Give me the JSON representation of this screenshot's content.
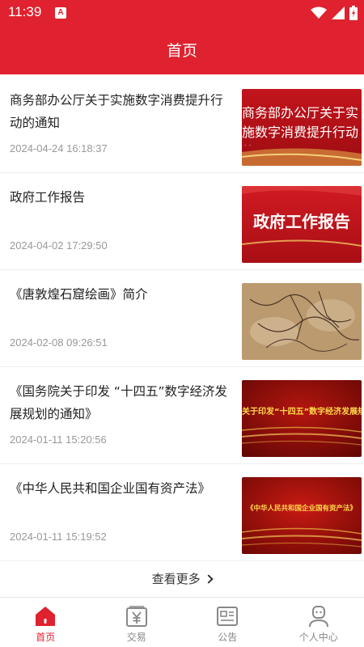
{
  "status_bar": {
    "time": "11:39",
    "notif_letter": "A"
  },
  "header": {
    "title": "首页"
  },
  "articles": [
    {
      "title": "商务部办公厅关于实施数字消费提升行动的通知",
      "time": "2024-04-24 16:18:37",
      "thumb_text": "商务部办公厅关于实施数字消费提升行动的通"
    },
    {
      "title": "政府工作报告",
      "time": "2024-04-02 17:29:50",
      "thumb_text": "政府工作报告"
    },
    {
      "title": "《唐敦煌石窟绘画》简介",
      "time": "2024-02-08 09:26:51",
      "thumb_text": ""
    },
    {
      "title": "《国务院关于印发 “十四五”数字经济发展规划的通知》",
      "time": "2024-01-11 15:20:56",
      "thumb_text": "关于印发“十四五”数字经济发展规划"
    },
    {
      "title": "《中华人民共和国企业国有资产法》",
      "time": "2024-01-11 15:19:52",
      "thumb_text": "《中华人民共和国企业国有资产法》"
    }
  ],
  "more_label": "查看更多",
  "tabs": [
    {
      "label": "首页",
      "icon": "home-icon",
      "active": true
    },
    {
      "label": "交易",
      "icon": "yuan-icon",
      "active": false
    },
    {
      "label": "公告",
      "icon": "notice-icon",
      "active": false
    },
    {
      "label": "个人中心",
      "icon": "person-icon",
      "active": false
    }
  ],
  "colors": {
    "brand_red": "#e0212f",
    "time_gray": "#999999",
    "tab_gray": "#888888"
  }
}
